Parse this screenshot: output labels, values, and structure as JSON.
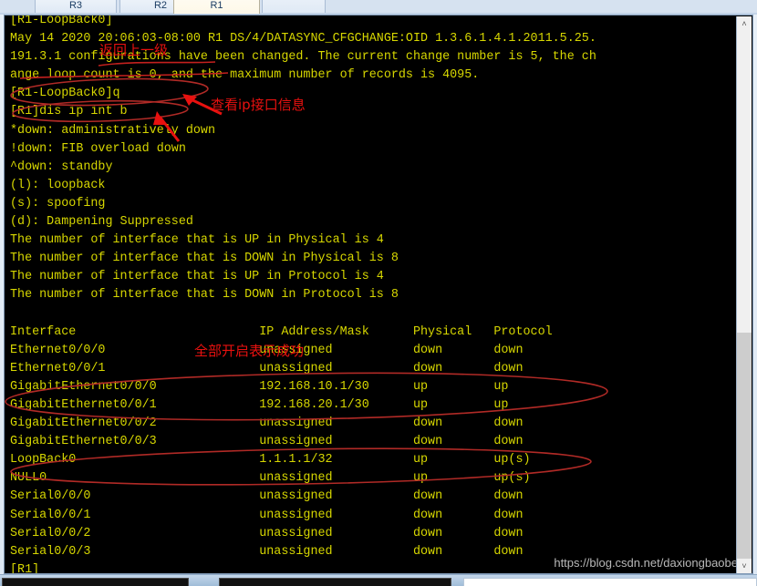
{
  "window": {
    "title": "R1",
    "scrollbar": {
      "up_arrow": "˄",
      "down_arrow": "˅"
    }
  },
  "tabs": [
    {
      "label": "R3",
      "active": false
    },
    {
      "label": "R2",
      "active": false
    },
    {
      "label": "R1",
      "active": true
    },
    {
      "label": "",
      "active": false
    }
  ],
  "terminal": {
    "lines": [
      "[R1-LoopBack0]",
      "May 14 2020 20:06:03-08:00 R1 DS/4/DATASYNC_CFGCHANGE:OID 1.3.6.1.4.1.2011.5.25.",
      "191.3.1 configurations have been changed. The current change number is 5, the ch",
      "ange loop count is 0, and the maximum number of records is 4095.",
      "[R1-LoopBack0]q",
      "[R1]dis ip int b",
      "*down: administratively down",
      "!down: FIB overload down",
      "^down: standby",
      "(l): loopback",
      "(s): spoofing",
      "(d): Dampening Suppressed",
      "The number of interface that is UP in Physical is 4",
      "The number of interface that is DOWN in Physical is 8",
      "The number of interface that is UP in Protocol is 4",
      "The number of interface that is DOWN in Protocol is 8",
      "",
      "Interface                         IP Address/Mask      Physical   Protocol",
      "Ethernet0/0/0                     unassigned           down       down",
      "Ethernet0/0/1                     unassigned           down       down",
      "GigabitEthernet0/0/0              192.168.10.1/30      up         up",
      "GigabitEthernet0/0/1              192.168.20.1/30      up         up",
      "GigabitEthernet0/0/2              unassigned           down       down",
      "GigabitEthernet0/0/3              unassigned           down       down",
      "LoopBack0                         1.1.1.1/32           up         up(s)",
      "NULL0                             unassigned           up         up(s)",
      "Serial0/0/0                       unassigned           down       down",
      "Serial0/0/1                       unassigned           down       down",
      "Serial0/0/2                       unassigned           down       down",
      "Serial0/0/3                       unassigned           down       down",
      "[R1]"
    ],
    "prompt_current": "[R1]",
    "commands": [
      {
        "prompt": "[R1-LoopBack0]",
        "command": "q"
      },
      {
        "prompt": "[R1]",
        "command": "dis ip int b"
      }
    ],
    "legend": [
      "*down: administratively down",
      "!down: FIB overload down",
      "^down: standby",
      "(l): loopback",
      "(s): spoofing",
      "(d): Dampening Suppressed"
    ],
    "counts": {
      "up_physical": "4",
      "down_physical": "8",
      "up_protocol": "4",
      "down_protocol": "8"
    },
    "table": {
      "headers": [
        "Interface",
        "IP Address/Mask",
        "Physical",
        "Protocol"
      ],
      "rows": [
        [
          "Ethernet0/0/0",
          "unassigned",
          "down",
          "down"
        ],
        [
          "Ethernet0/0/1",
          "unassigned",
          "down",
          "down"
        ],
        [
          "GigabitEthernet0/0/0",
          "192.168.10.1/30",
          "up",
          "up"
        ],
        [
          "GigabitEthernet0/0/1",
          "192.168.20.1/30",
          "up",
          "up"
        ],
        [
          "GigabitEthernet0/0/2",
          "unassigned",
          "down",
          "down"
        ],
        [
          "GigabitEthernet0/0/3",
          "unassigned",
          "down",
          "down"
        ],
        [
          "LoopBack0",
          "1.1.1.1/32",
          "up",
          "up(s)"
        ],
        [
          "NULL0",
          "unassigned",
          "up",
          "up(s)"
        ],
        [
          "Serial0/0/0",
          "unassigned",
          "down",
          "down"
        ],
        [
          "Serial0/0/1",
          "unassigned",
          "down",
          "down"
        ],
        [
          "Serial0/0/2",
          "unassigned",
          "down",
          "down"
        ],
        [
          "Serial0/0/3",
          "unassigned",
          "down",
          "down"
        ]
      ]
    }
  },
  "annotations": [
    {
      "id": "return-up-level",
      "text": "返回上一级"
    },
    {
      "id": "view-ip-interface",
      "text": "查看ip接口信息"
    },
    {
      "id": "all-up-success",
      "text": "全部开启表示成功"
    }
  ],
  "watermark": "https://blog.csdn.net/daxiongbaobe",
  "colors": {
    "terminal_bg": "#000000",
    "terminal_fg": "#d7d700",
    "annotation": "#e8110f",
    "tab_active_bg": "#fffdf6",
    "chrome_bg": "#d6e2f0"
  }
}
